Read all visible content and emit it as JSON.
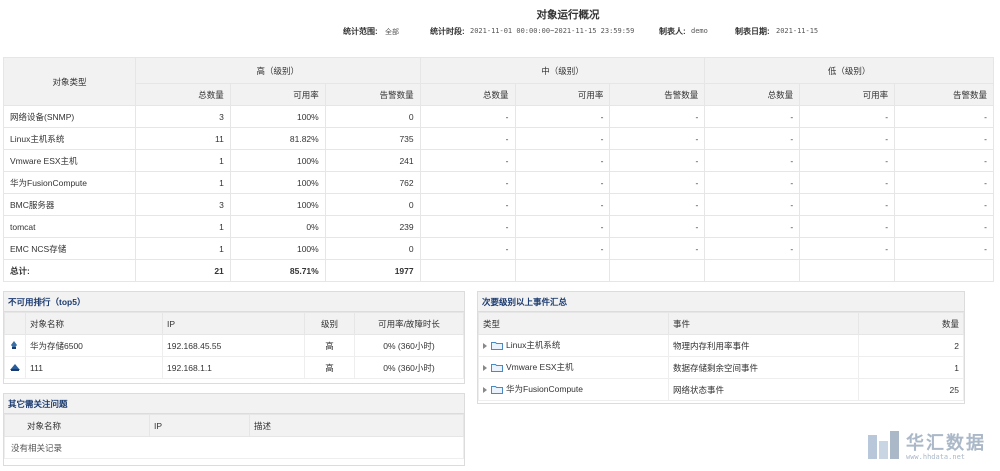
{
  "title": "对象运行概况",
  "meta": {
    "range_label": "统计范围:",
    "range_value": "全部",
    "period_label": "统计时段:",
    "period_value": "2021-11-01 00:00:00~2021-11-15 23:59:59",
    "maker_label": "制表人:",
    "maker_value": "demo",
    "date_label": "制表日期:",
    "date_value": "2021-11-15"
  },
  "main": {
    "col_type": "对象类型",
    "levels": [
      "高（级别）",
      "中（级别）",
      "低（级别）"
    ],
    "sub": [
      "总数量",
      "可用率",
      "告警数量"
    ],
    "rows": [
      {
        "name": "网络设备(SNMP)",
        "total": "3",
        "avail": "100%",
        "alarm": "0",
        "red": false
      },
      {
        "name": "Linux主机系统",
        "total": "11",
        "avail": "81.82%",
        "alarm": "735",
        "red": true
      },
      {
        "name": "Vmware ESX主机",
        "total": "1",
        "avail": "100%",
        "alarm": "241",
        "red": false
      },
      {
        "name": "华为FusionCompute",
        "total": "1",
        "avail": "100%",
        "alarm": "762",
        "red": false
      },
      {
        "name": "BMC服务器",
        "total": "3",
        "avail": "100%",
        "alarm": "0",
        "red": false
      },
      {
        "name": "tomcat",
        "total": "1",
        "avail": "0%",
        "alarm": "239",
        "red": true
      },
      {
        "name": "EMC NCS存储",
        "total": "1",
        "avail": "100%",
        "alarm": "0",
        "red": false
      }
    ],
    "dash": "-",
    "total_row": {
      "name": "总计:",
      "total": "21",
      "avail": "85.71%",
      "alarm": "1977"
    }
  },
  "unavail": {
    "title": "不可用排行（top5）",
    "headers": [
      "对象名称",
      "IP",
      "级别",
      "可用率/故障时长"
    ],
    "rows": [
      {
        "icon": "storage-icon",
        "name": "华为存储6500",
        "ip": "192.168.45.55",
        "level": "高",
        "rate": "0% (360小时)"
      },
      {
        "icon": "switch-icon",
        "name": "111",
        "ip": "192.168.1.1",
        "level": "高",
        "rate": "0% (360小时)"
      }
    ]
  },
  "other": {
    "title": "其它需关注问题",
    "headers": [
      "对象名称",
      "IP",
      "描述"
    ],
    "empty": "没有相关记录"
  },
  "events": {
    "title": "次要级别以上事件汇总",
    "headers": [
      "类型",
      "事件",
      "数量"
    ],
    "rows": [
      {
        "type": "Linux主机系统",
        "event": "物理内存利用率事件",
        "count": "2"
      },
      {
        "type": "Vmware ESX主机",
        "event": "数据存储剩余空间事件",
        "count": "1"
      },
      {
        "type": "华为FusionCompute",
        "event": "网络状态事件",
        "count": "25"
      }
    ]
  },
  "watermark": {
    "text": "华汇数据",
    "url": "www.hhdata.net"
  },
  "colors": {
    "header_bg": "#f2f2f2",
    "accent": "#1b3a70",
    "alert": "#b30000"
  }
}
